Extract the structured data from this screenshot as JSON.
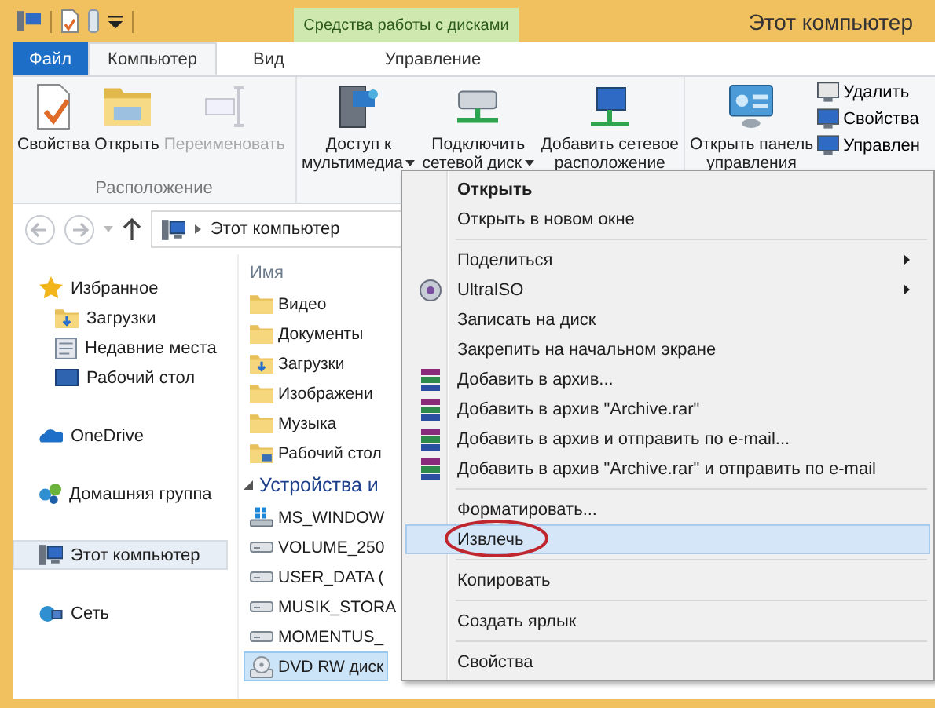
{
  "title_bar": {
    "context_group": "Средства работы с дисками",
    "title": "Этот компьютер"
  },
  "tabs": [
    {
      "label": "Файл",
      "kind": "file",
      "selected": false
    },
    {
      "label": "Компьютер",
      "kind": "tab",
      "selected": true
    },
    {
      "label": "Вид",
      "kind": "tab",
      "selected": false
    },
    {
      "label": "Управление",
      "kind": "context",
      "selected": false
    }
  ],
  "ribbon": {
    "groups": [
      {
        "label": "Расположение",
        "buttons": [
          {
            "lines": [
              "Свойства"
            ],
            "disabled": false,
            "dropdown": false
          },
          {
            "lines": [
              "Открыть"
            ],
            "disabled": false,
            "dropdown": false
          },
          {
            "lines": [
              "Переименовать"
            ],
            "disabled": true,
            "dropdown": false
          }
        ]
      },
      {
        "buttons": [
          {
            "lines": [
              "Доступ к",
              "мультимедиа"
            ],
            "disabled": false,
            "dropdown": true
          },
          {
            "lines": [
              "Подключить",
              "сетевой диск"
            ],
            "disabled": false,
            "dropdown": true
          },
          {
            "lines": [
              "Добавить сетевое",
              "расположение"
            ],
            "disabled": false,
            "dropdown": false
          }
        ]
      },
      {
        "buttons": [
          {
            "lines": [
              "Открыть панель",
              "управления"
            ],
            "disabled": false,
            "dropdown": false
          }
        ],
        "small_buttons": [
          {
            "label": "Удалить"
          },
          {
            "label": "Свойства"
          },
          {
            "label": "Управлен"
          }
        ]
      }
    ]
  },
  "address_bar": {
    "path": "Этот компьютер"
  },
  "navigation": [
    {
      "label": "Избранное",
      "selected": false,
      "children": [
        {
          "label": "Загрузки",
          "selected": false
        },
        {
          "label": "Недавние места",
          "selected": false
        },
        {
          "label": "Рабочий стол",
          "selected": false
        }
      ]
    },
    {
      "label": "OneDrive",
      "selected": false
    },
    {
      "label": "Домашняя группа",
      "selected": false
    },
    {
      "label": "Этот компьютер",
      "selected": true
    },
    {
      "label": "Сеть",
      "selected": false
    }
  ],
  "content": {
    "column": "Имя",
    "folders": [
      "Видео",
      "Документы",
      "Загрузки",
      "Изображени",
      "Музыка",
      "Рабочий стол"
    ],
    "group": "Устройства и",
    "drives": [
      {
        "label": "MS_WINDOW",
        "selected": false
      },
      {
        "label": "VOLUME_250",
        "selected": false
      },
      {
        "label": "USER_DATA (",
        "selected": false
      },
      {
        "label": "MUSIK_STORA",
        "selected": false
      },
      {
        "label": "MOMENTUS_",
        "selected": false
      },
      {
        "label": "DVD RW диск",
        "selected": true
      }
    ]
  },
  "context_menu": [
    {
      "kind": "item",
      "label": "Открыть",
      "bold": true,
      "selected": false
    },
    {
      "kind": "item",
      "label": "Открыть в новом окне",
      "bold": false,
      "selected": false
    },
    {
      "kind": "separator"
    },
    {
      "kind": "item",
      "label": "Поделиться",
      "submenu": true,
      "bold": false,
      "selected": false
    },
    {
      "kind": "item",
      "label": "UltraISO",
      "submenu": true,
      "bold": false,
      "selected": false
    },
    {
      "kind": "item",
      "label": "Записать на диск",
      "bold": false,
      "selected": false
    },
    {
      "kind": "item",
      "label": "Закрепить на начальном экране",
      "bold": false,
      "selected": false
    },
    {
      "kind": "item",
      "label": "Добавить в архив...",
      "bold": false,
      "selected": false
    },
    {
      "kind": "item",
      "label": "Добавить в архив \"Archive.rar\"",
      "bold": false,
      "selected": false
    },
    {
      "kind": "item",
      "label": "Добавить в архив и отправить по e-mail...",
      "bold": false,
      "selected": false
    },
    {
      "kind": "item",
      "label": "Добавить в архив \"Archive.rar\" и отправить по e-mail",
      "bold": false,
      "selected": false
    },
    {
      "kind": "separator"
    },
    {
      "kind": "item",
      "label": "Форматировать...",
      "bold": false,
      "selected": false
    },
    {
      "kind": "item",
      "label": "Извлечь",
      "bold": false,
      "selected": true,
      "circled": true
    },
    {
      "kind": "separator"
    },
    {
      "kind": "item",
      "label": "Копировать",
      "bold": false,
      "selected": false
    },
    {
      "kind": "separator"
    },
    {
      "kind": "item",
      "label": "Создать ярлык",
      "bold": false,
      "selected": false
    },
    {
      "kind": "separator"
    },
    {
      "kind": "item",
      "label": "Свойства",
      "bold": false,
      "selected": false
    }
  ]
}
